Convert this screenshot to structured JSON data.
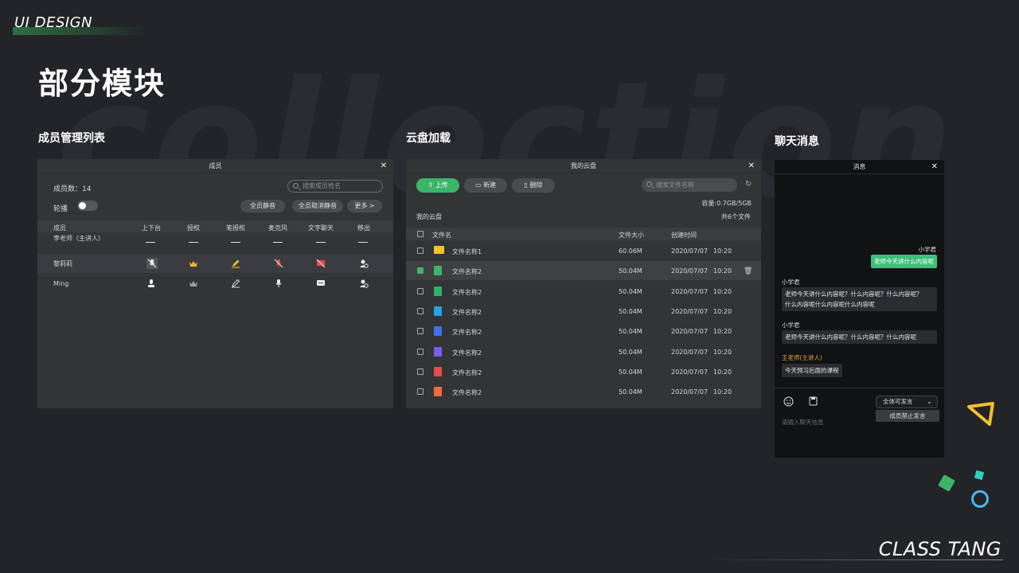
{
  "brand": "UI DESIGN",
  "page_title": "部分模块",
  "bg_word": "collection",
  "footer": "CLASS TANG",
  "sections": {
    "members": "成员管理列表",
    "cloud": "云盘加载",
    "chat": "聊天消息"
  },
  "members_panel": {
    "title": "成员",
    "count_label": "成员数：14",
    "search_placeholder": "搜索成员姓名",
    "toggle_label": "轮播",
    "btn_mute_all": "全员静音",
    "btn_unmute_all": "全员取消静音",
    "btn_more": "更多 >",
    "columns": [
      "成员",
      "上下台",
      "授权",
      "笔授权",
      "麦克风",
      "文字聊天",
      "移出"
    ],
    "rows": [
      {
        "name": "李老师（主讲人）"
      },
      {
        "name": "黎莉莉"
      },
      {
        "name": "Ming"
      }
    ]
  },
  "cloud_panel": {
    "title": "我的云盘",
    "btn_upload": "上传",
    "btn_new": "新建",
    "btn_delete": "删除",
    "search_placeholder": "搜索文件名称",
    "capacity": "容量:0.7GB/5GB",
    "breadcrumb": "我的云盘",
    "file_count": "共6个文件",
    "columns": [
      "文件名",
      "文件大小",
      "创建时间"
    ],
    "files": [
      {
        "name": "文件名称1",
        "size": "60.06M",
        "date": "2020/07/07",
        "time": "10:20",
        "icon": "folder-icon",
        "color": "#f2c12e",
        "checked": false
      },
      {
        "name": "文件名称2",
        "size": "50.04M",
        "date": "2020/07/07",
        "time": "10:20",
        "icon": "image-file-icon",
        "color": "#3cb569",
        "checked": true
      },
      {
        "name": "文件名称2",
        "size": "50.04M",
        "date": "2020/07/07",
        "time": "10:20",
        "icon": "ppt-file-icon",
        "color": "#2fb36b",
        "checked": false
      },
      {
        "name": "文件名称2",
        "size": "50.04M",
        "date": "2020/07/07",
        "time": "10:20",
        "icon": "word-file-icon",
        "color": "#25a3e8",
        "checked": false
      },
      {
        "name": "文件名称2",
        "size": "50.04M",
        "date": "2020/07/07",
        "time": "10:20",
        "icon": "video-file-icon",
        "color": "#3a72e8",
        "checked": false
      },
      {
        "name": "文件名称2",
        "size": "50.04M",
        "date": "2020/07/07",
        "time": "10:20",
        "icon": "audio-file-icon",
        "color": "#7a5cf0",
        "checked": false
      },
      {
        "name": "文件名称2",
        "size": "50.04M",
        "date": "2020/07/07",
        "time": "10:20",
        "icon": "pdf-file-icon",
        "color": "#e84b4b",
        "checked": false
      },
      {
        "name": "文件名称2",
        "size": "50.04M",
        "date": "2020/07/07",
        "time": "10:20",
        "icon": "excel-file-icon",
        "color": "#f06a3a",
        "checked": false
      }
    ]
  },
  "chat_panel": {
    "title": "消息",
    "messages": [
      {
        "user": "小学君",
        "text": "老师今天讲什么内容呢",
        "mine": true
      },
      {
        "user": "小学君",
        "text1": "老师今天讲什么内容呢？什么内容呢？什么内容呢？",
        "text2": "什么内容呢什么内容呢什么内容呢"
      },
      {
        "user": "小学君",
        "text": "老师今天讲什么内容呢？什么内容呢？什么内容呢"
      },
      {
        "user": "王老师(主讲人)",
        "text": "今天预习后面的课程",
        "accent": "#e5a23a"
      }
    ],
    "dropdown_value": "全体可发言",
    "dropdown_option": "成员禁止发言",
    "input_placeholder": "请输入聊天信息"
  }
}
